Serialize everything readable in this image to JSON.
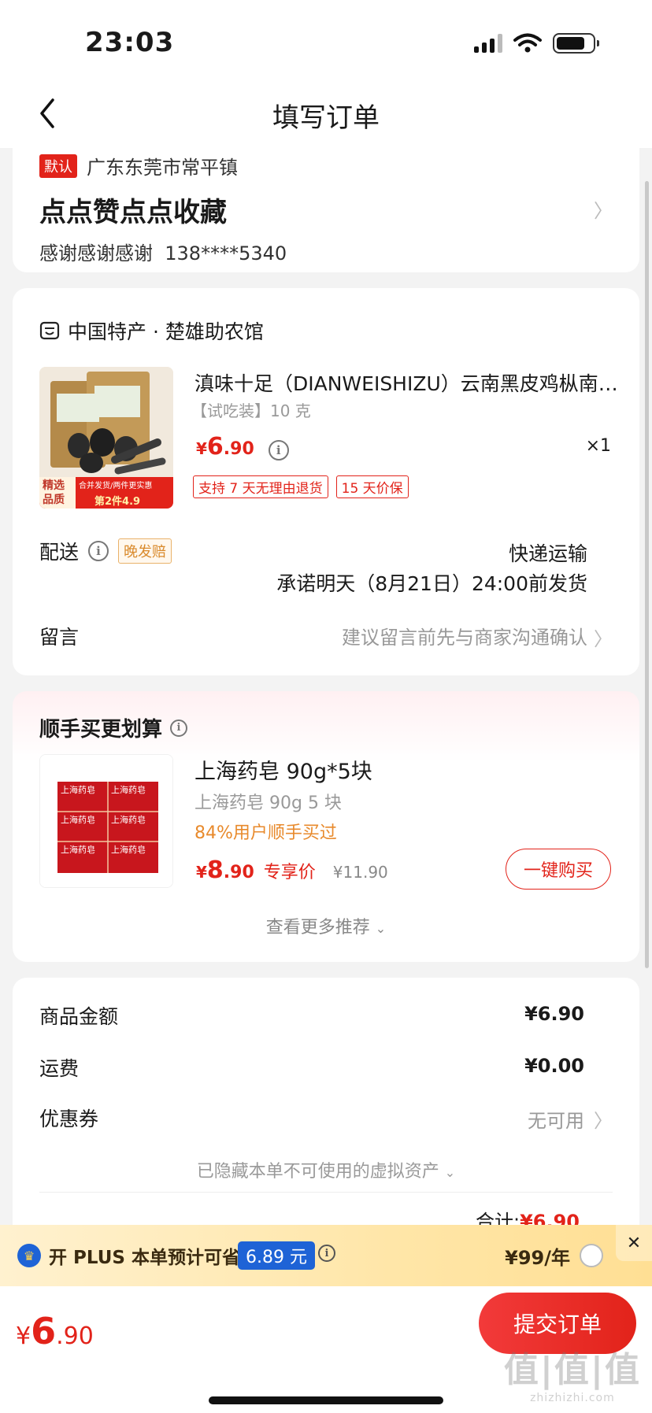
{
  "status_bar": {
    "time": "23:03"
  },
  "nav": {
    "title": "填写订单"
  },
  "address": {
    "default_tag": "默认",
    "region": "广东东莞市常平镇",
    "detail": "点点赞点点收藏",
    "name": "感谢感谢感谢",
    "phone": "138****5340"
  },
  "shop": {
    "name": "中国特产 · 楚雄助农馆",
    "product": {
      "title": "滇味十足（DIANWEISHIZU）云南黑皮鸡枞南…",
      "spec": "【试吃装】10 克",
      "price_yen": "¥",
      "price_int": "6",
      "price_dec": ".90",
      "qty": "×1",
      "badge_left": "精选品质",
      "badge_mid": "合并发货/两件更实惠",
      "badge_right": "第2件4.9",
      "service_tags": [
        "支持 7 天无理由退货",
        "15 天价保"
      ]
    },
    "delivery": {
      "label": "配送",
      "late_tag": "晚发赔",
      "method": "快递运输",
      "promise": "承诺明天（8月21日）24:00前发货"
    },
    "note": {
      "label": "留言",
      "hint": "建议留言前先与商家沟通确认"
    }
  },
  "recommend": {
    "title": "顺手买更划算",
    "item": {
      "name": "上海药皂 90g*5块",
      "spec": "上海药皂 90g 5 块",
      "hot": "84%用户顺手买过",
      "price_yen": "¥",
      "price_int": "8",
      "price_dec": ".90",
      "price_label": "专享价",
      "old_price": "¥11.90",
      "image_label": "上海药皂",
      "buy_label": "一键购买"
    },
    "more_label": "查看更多推荐"
  },
  "summary": {
    "goods_label": "商品金额",
    "goods_value": "¥6.90",
    "freight_label": "运费",
    "freight_value": "¥0.00",
    "coupon_label": "优惠券",
    "coupon_value": "无可用",
    "hidden_assets": "已隐藏本单不可使用的虚拟资产",
    "total_label": "合计:",
    "total_value": "¥6.90"
  },
  "plus_bar": {
    "text": "开 PLUS 本单预计可省",
    "save": "6.89 元",
    "price": "¥99/年"
  },
  "bottom": {
    "price_yen": "¥",
    "price_int": "6",
    "price_dec": ".90",
    "submit_label": "提交订单",
    "watermark_main": "值|值|值",
    "watermark_sub": "zhizhizhi.com"
  },
  "colors": {
    "accent": "#e2231a",
    "plus_blue": "#1e63d6",
    "plus_bg": "#ffe6a8"
  }
}
